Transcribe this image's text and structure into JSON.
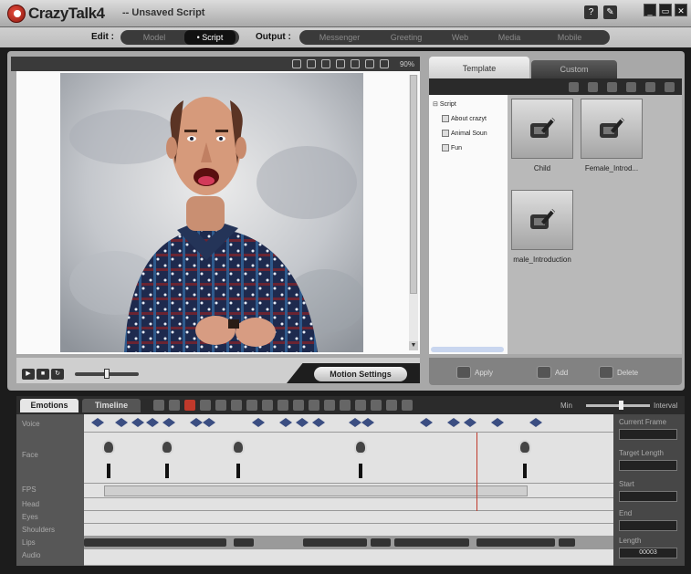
{
  "app": {
    "logo_text": "CrazyTalk4",
    "doc_title": "-- Unsaved Script"
  },
  "title_icons": {
    "help": "?",
    "tool": "✎"
  },
  "window_buttons": {
    "minimize": "_",
    "restore": "▭",
    "close": "✕"
  },
  "modebar": {
    "edit_label": "Edit :",
    "edit_tabs": [
      {
        "label": "Model",
        "active": false
      },
      {
        "label": "• Script",
        "active": true
      }
    ],
    "output_label": "Output :",
    "output_tabs": [
      "Messenger",
      "Greeting",
      "Web",
      "Media",
      "Mobile"
    ]
  },
  "viewport": {
    "zoom": "90%",
    "motion_settings": "Motion Settings"
  },
  "library": {
    "tabs": [
      "Template",
      "Custom"
    ],
    "tree": [
      {
        "label": "Script",
        "level": 0
      },
      {
        "label": "About crazyt",
        "level": 1
      },
      {
        "label": "Animal Soun",
        "level": 1
      },
      {
        "label": "Fun",
        "level": 1
      }
    ],
    "items": [
      "Child",
      "Female_Introd...",
      "male_Introduction"
    ],
    "actions": [
      "Apply",
      "Add",
      "Delete"
    ]
  },
  "timeline": {
    "tabs": [
      "Emotions",
      "Timeline"
    ],
    "zoom_min": "Min",
    "zoom_max": "Interval",
    "tracks": [
      "Voice",
      "Face",
      "FPS",
      "Head",
      "Eyes",
      "Shoulders",
      "Lips",
      "Audio"
    ],
    "props": [
      "Current Frame",
      "Target Length",
      "Start",
      "End",
      "Length"
    ],
    "length_value": "00003"
  },
  "colors": {
    "accent_red": "#c0392b",
    "voice_key": "#3b4e82"
  }
}
